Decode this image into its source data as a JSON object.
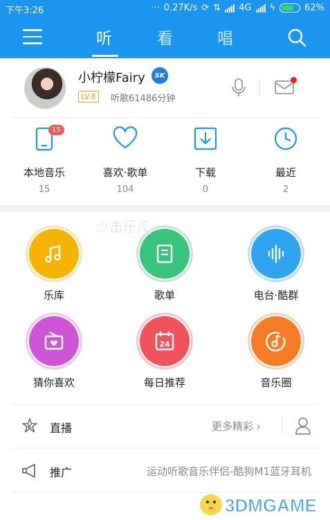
{
  "status_bar": {
    "time": "下午3:26",
    "speed": "0.27K/s",
    "network": "4G",
    "battery": "62%"
  },
  "nav": {
    "tabs": [
      {
        "label": "听",
        "active": true
      },
      {
        "label": "看",
        "active": false
      },
      {
        "label": "唱",
        "active": false
      }
    ]
  },
  "profile": {
    "username": "小柠檬Fairy",
    "vip_badge": "SK",
    "level": "LV.8",
    "listen_time": "听歌61486分钟"
  },
  "quick_items": [
    {
      "label": "本地音乐",
      "count": "15",
      "badge": "15",
      "icon": "phone-icon"
    },
    {
      "label": "喜欢·歌单",
      "count": "104",
      "icon": "heart-icon"
    },
    {
      "label": "下载",
      "count": "0",
      "icon": "download-icon"
    },
    {
      "label": "最近",
      "count": "2",
      "icon": "clock-icon"
    }
  ],
  "overlay_hint": "点击乐库",
  "circles": [
    {
      "label": "乐库",
      "color": "#f6b400",
      "icon": "music-note-icon"
    },
    {
      "label": "歌单",
      "color": "#3ac37a",
      "icon": "playlist-icon"
    },
    {
      "label": "电台·酷群",
      "color": "#2fa4f0",
      "icon": "soundwave-icon"
    },
    {
      "label": "猜你喜欢",
      "color": "#cf55d8",
      "icon": "radio-icon"
    },
    {
      "label": "每日推荐",
      "color": "#f0535a",
      "icon": "calendar-icon",
      "day": "24"
    },
    {
      "label": "音乐圈",
      "color": "#f57c24",
      "icon": "music-circle-icon"
    }
  ],
  "list_rows": [
    {
      "label": "直播",
      "right_text": "更多精彩",
      "icon": "live-k-icon"
    },
    {
      "label": "推广",
      "right_text": "运动听歌音乐伴侣-酷狗M1蓝牙耳机",
      "icon": "megaphone-icon"
    }
  ],
  "watermark": "3DMGAME",
  "colors": {
    "brand_blue": "#1a96f0",
    "badge_red": "#f25a5a",
    "level_orange": "#f0a020"
  }
}
